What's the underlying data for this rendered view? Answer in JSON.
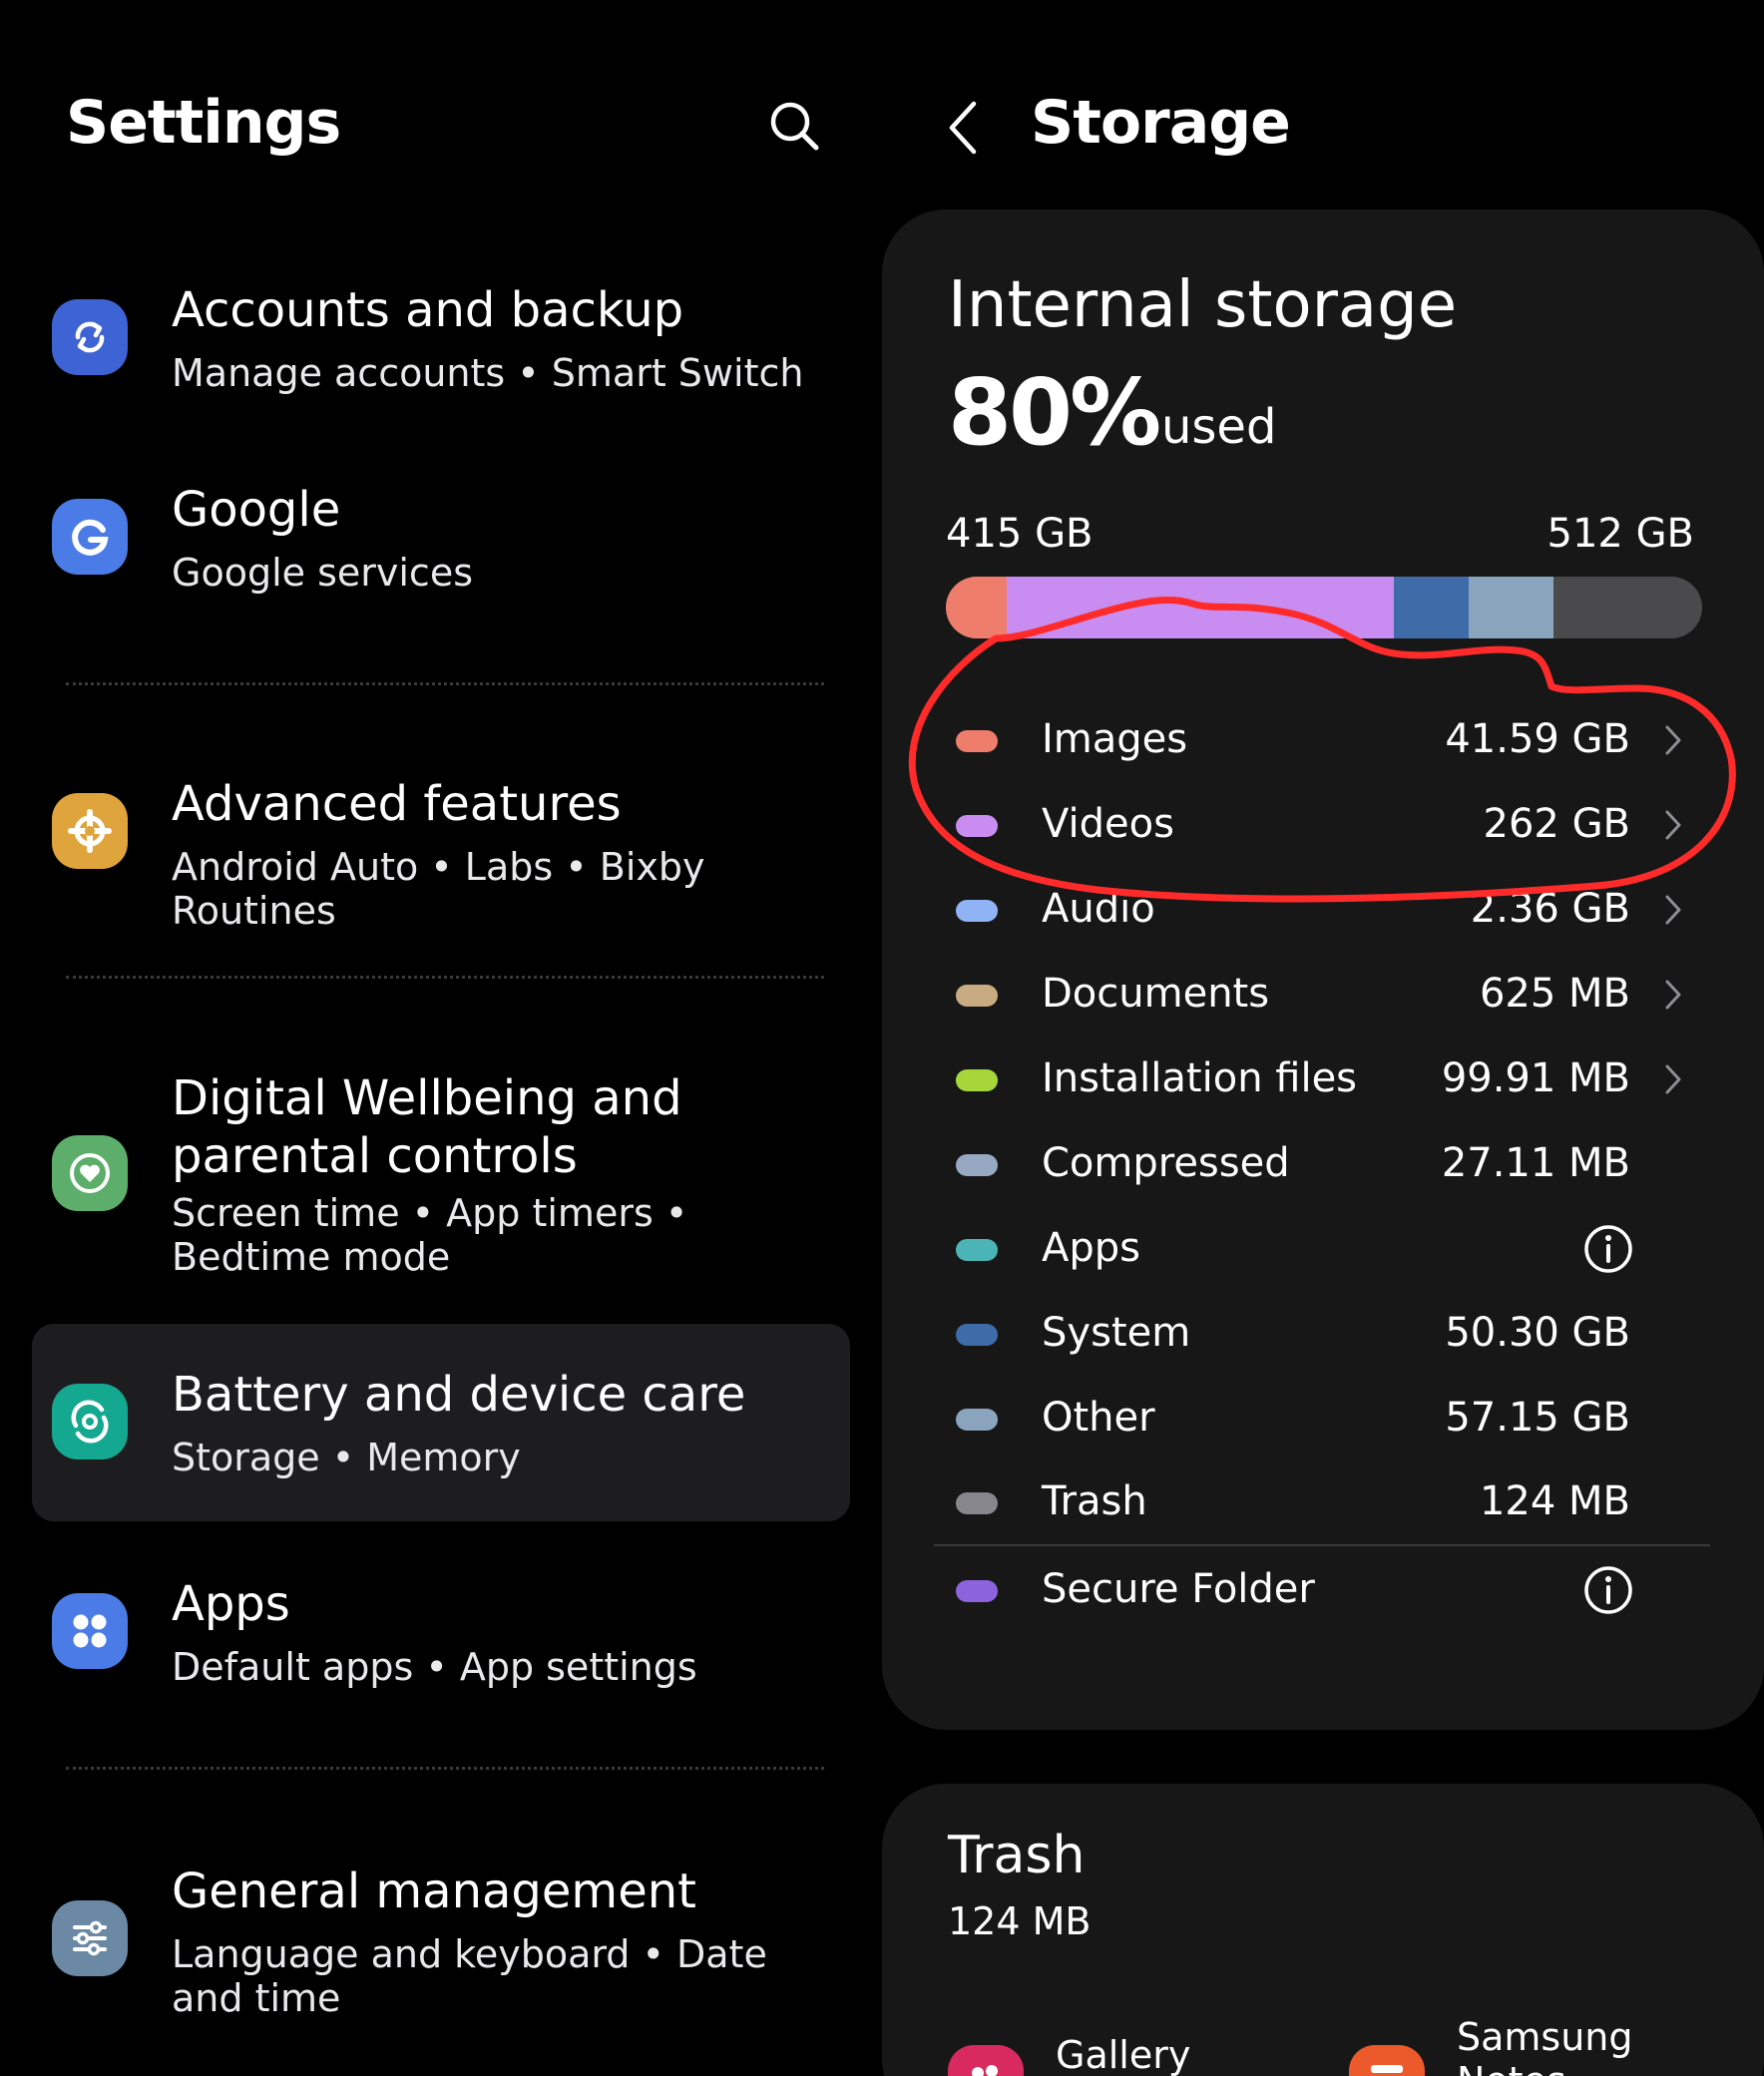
{
  "settings": {
    "title": "Settings",
    "items": [
      {
        "title": "Accounts and backup",
        "subtitle": "Manage accounts  •  Smart Switch"
      },
      {
        "title": "Google",
        "subtitle": "Google services"
      },
      {
        "title": "Advanced features",
        "subtitle": "Android Auto  •  Labs  •  Bixby Routines"
      },
      {
        "title": "Digital Wellbeing and parental controls",
        "subtitle": "Screen time  •  App timers  •  Bedtime mode"
      },
      {
        "title": "Battery and device care",
        "subtitle": "Storage  •  Memory"
      },
      {
        "title": "Apps",
        "subtitle": "Default apps  •  App settings"
      },
      {
        "title": "General management",
        "subtitle": "Language and keyboard  •  Date and time"
      }
    ]
  },
  "storage": {
    "title": "Storage",
    "heading": "Internal storage",
    "used_percent": "80%",
    "used_word": "used",
    "used_gb": "415 GB",
    "total_gb": "512 GB",
    "categories": [
      {
        "name": "Images",
        "size": "41.59 GB",
        "color": "#ef7d6c"
      },
      {
        "name": "Videos",
        "size": "262 GB",
        "color": "#c98df2"
      },
      {
        "name": "Audio",
        "size": "2.36 GB",
        "color": "#8fb3f5"
      },
      {
        "name": "Documents",
        "size": "625 MB",
        "color": "#c9ab82"
      },
      {
        "name": "Installation files",
        "size": "99.91 MB",
        "color": "#a6d63a"
      },
      {
        "name": "Compressed",
        "size": "27.11 MB",
        "color": "#97a9c2"
      },
      {
        "name": "Apps",
        "size": "",
        "color": "#4bb4b6"
      },
      {
        "name": "System",
        "size": "50.30 GB",
        "color": "#3f6ba8"
      },
      {
        "name": "Other",
        "size": "57.15 GB",
        "color": "#8aa4bd"
      },
      {
        "name": "Trash",
        "size": "124 MB",
        "color": "#86868c"
      },
      {
        "name": "Secure Folder",
        "size": "",
        "color": "#8b63dd"
      }
    ]
  },
  "trash": {
    "title": "Trash",
    "size": "124 MB",
    "apps": [
      {
        "label": "Gallery"
      },
      {
        "label": "Samsung Notes"
      }
    ]
  },
  "colors": {
    "background": "#000000",
    "card": "#171717",
    "selected_item": "#1d1d1f",
    "annotation": "#ff2b2b",
    "bar_remainder": "#4a4a4c",
    "bar_system": "#3f6ba8",
    "bar_other": "#8aa4bd"
  },
  "icons": {
    "search": "search-icon",
    "back": "back-arrow-icon",
    "chevron": "chevron-right-icon",
    "info": "info-icon"
  }
}
